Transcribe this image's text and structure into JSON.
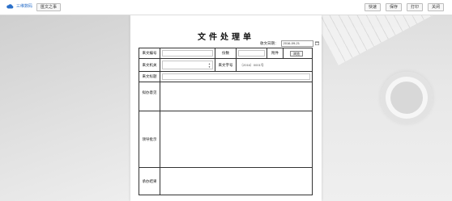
{
  "app": {
    "logo_text": "三维数码"
  },
  "toolbar": {
    "tab_label": "匯文之事",
    "buttons": [
      "快速",
      "保存",
      "打印",
      "关闭"
    ]
  },
  "form": {
    "title": "文件处理单",
    "receive_date_label": "收文日期：",
    "receive_date_value": "2016-09-21",
    "fields": {
      "receive_no": "来文编号",
      "copies": "份数",
      "attachment": "附件",
      "attachment_button": "浏览",
      "from_org": "来文机关",
      "doc_no_label": "来文字号",
      "doc_no_value": "〔2016〕0001号",
      "doc_title": "来文标题",
      "draft_opinion": "拟办意见",
      "leader_instruction": "领导批示",
      "handling_result": "承办结果"
    }
  },
  "colors": {
    "accent": "#2a6fc9",
    "border": "#333333",
    "background": "#e8e8e8"
  }
}
